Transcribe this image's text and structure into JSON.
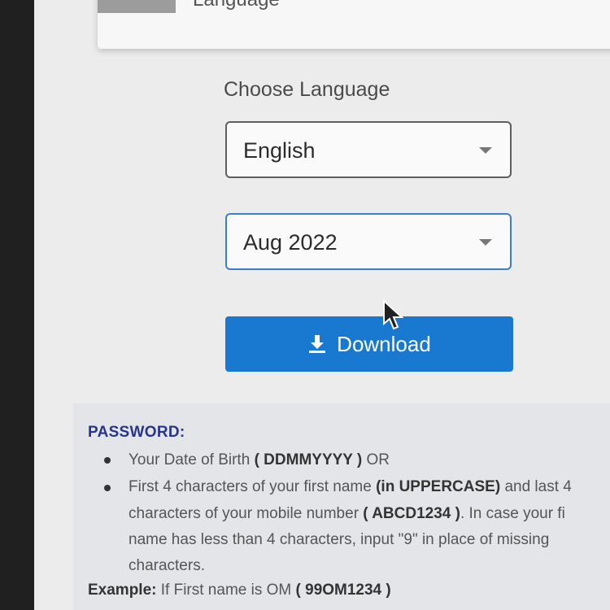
{
  "top_card": {
    "label": "Language"
  },
  "form": {
    "choose_label": "Choose Language",
    "language_select": {
      "value": "English"
    },
    "month_select": {
      "value": "Aug 2022"
    },
    "download_label": "Download"
  },
  "password_info": {
    "title": "PASSWORD:",
    "bullet1": {
      "pre": "Your Date of Birth ",
      "bold": "( DDMMYYYY )",
      "post": " OR"
    },
    "bullet2": {
      "line1_pre": "First 4 characters of your first name ",
      "line1_bold": "(in UPPERCASE)",
      "line1_post": " and last 4",
      "line2_pre": "characters of your mobile number ",
      "line2_bold": "( ABCD1234 )",
      "line2_post": ". In case your fi",
      "line3": "name has less than 4 characters, input \"9\" in place of missing",
      "line4": "characters."
    },
    "example": {
      "label": "Example:",
      "text": " If First name is OM ",
      "bold": "( 99OM1234 )"
    }
  },
  "colors": {
    "accent": "#1978cf",
    "title": "#27358a",
    "focus_border": "#3b80c4"
  },
  "icons": {
    "download": "download-icon",
    "caret": "chevron-down-icon",
    "cursor": "mouse-cursor-icon"
  }
}
